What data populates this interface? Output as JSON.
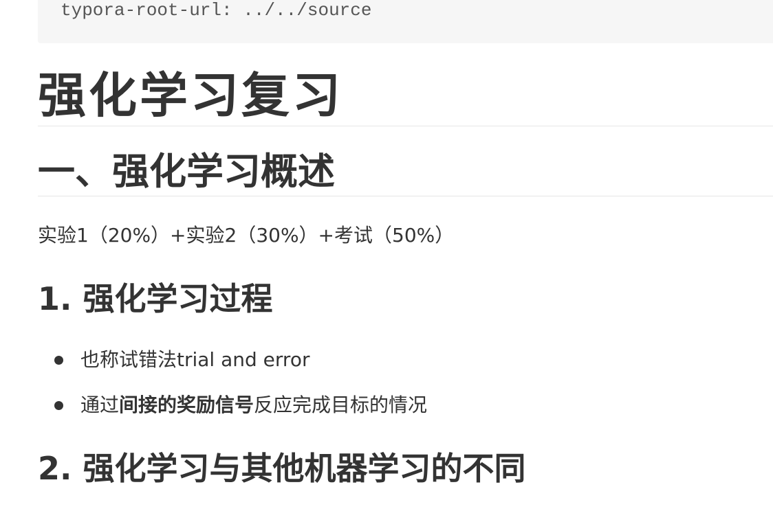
{
  "front_matter": {
    "code_line": "typora-root-url: ../../source"
  },
  "document": {
    "h1": "强化学习复习",
    "h2": "一、强化学习概述",
    "grading_text": "实验1（20%）+实验2（30%）+考试（50%）",
    "section_1": {
      "title": "1. 强化学习过程",
      "bullets": [
        {
          "before": "也称试错法trial and error",
          "bold": "",
          "after": ""
        },
        {
          "before": "通过",
          "bold": "间接的奖励信号",
          "after": "反应完成目标的情况"
        }
      ]
    },
    "section_2": {
      "title": "2. 强化学习与其他机器学习的不同"
    }
  }
}
